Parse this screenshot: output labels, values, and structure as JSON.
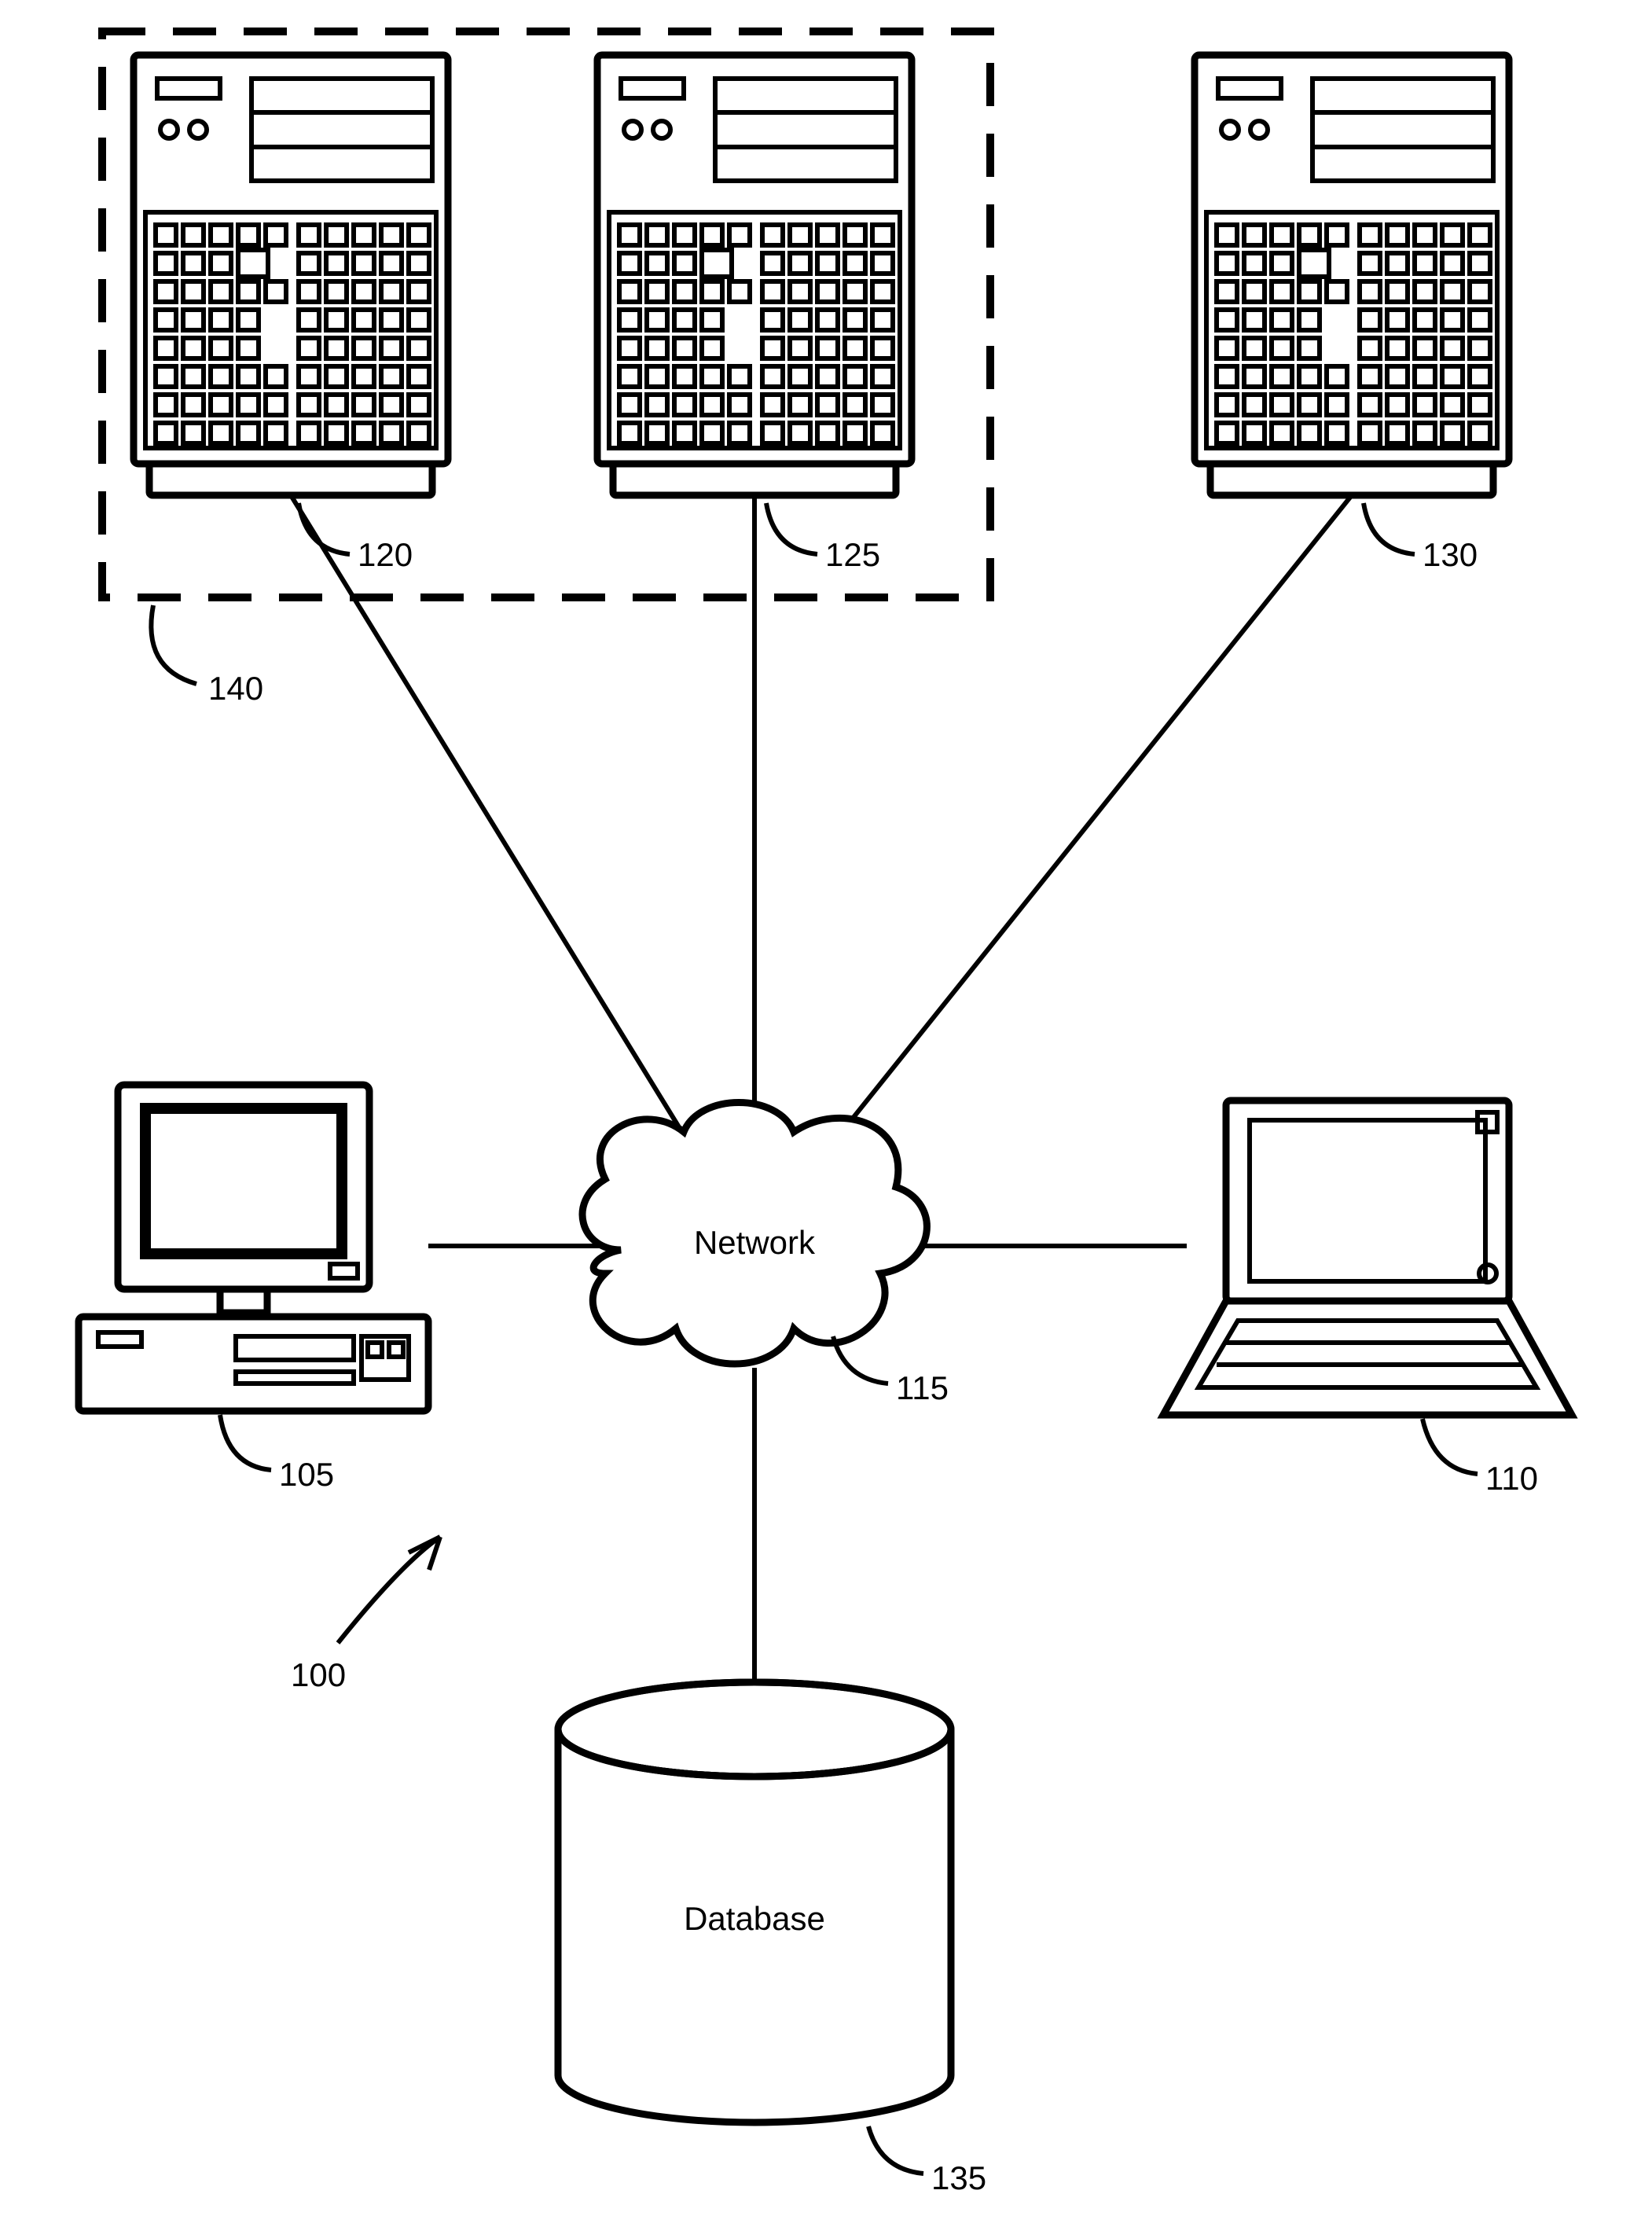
{
  "labels": {
    "network": "Network",
    "database": "Database"
  },
  "refs": {
    "figure": "100",
    "desktop": "105",
    "laptop": "110",
    "network_cloud": "115",
    "server_a": "120",
    "server_b": "125",
    "server_c": "130",
    "database": "135",
    "group_box": "140"
  }
}
